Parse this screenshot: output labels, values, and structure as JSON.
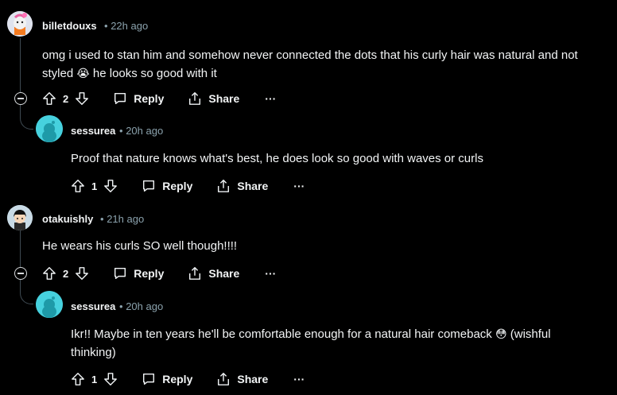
{
  "comments": [
    {
      "username": "billetdouxs",
      "time": "22h ago",
      "text_line1": "omg i used to stan him and somehow never connected the dots that his curly hair was natural and not",
      "text_line2a": "styled",
      "text_line2b": "he looks so good with it",
      "emoji": "😭",
      "votes": "2",
      "reply_label": "Reply",
      "share_label": "Share",
      "more_label": "···"
    },
    {
      "username": "sessurea",
      "time": "20h ago",
      "text": "Proof that nature knows what's best, he does look so good with waves or curls",
      "votes": "1",
      "reply_label": "Reply",
      "share_label": "Share",
      "more_label": "···"
    },
    {
      "username": "otakuishly",
      "time": "21h ago",
      "text": "He wears his curls SO well though!!!!",
      "votes": "2",
      "reply_label": "Reply",
      "share_label": "Share",
      "more_label": "···"
    },
    {
      "username": "sessurea",
      "time": "20h ago",
      "text_line1a": "Ikr!! Maybe in ten years he'll be comfortable enough for a natural hair comeback",
      "text_line1b": "(wishful",
      "text_line2": "thinking)",
      "emoji": "😳",
      "votes": "1",
      "reply_label": "Reply",
      "share_label": "Share",
      "more_label": "···"
    }
  ],
  "separator": "•"
}
